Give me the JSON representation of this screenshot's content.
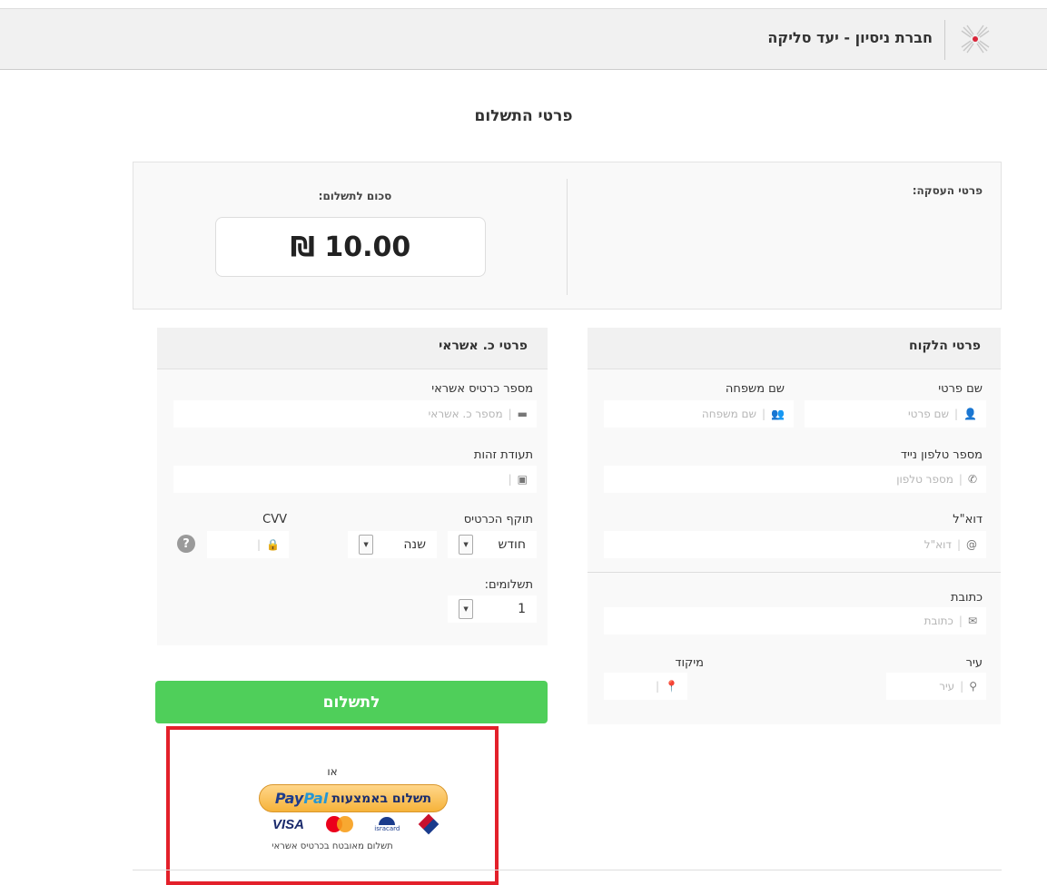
{
  "header": {
    "company_name": "חברת ניסיון - יעד סליקה"
  },
  "page": {
    "title": "פרטי התשלום"
  },
  "summary": {
    "deal_details_label": "פרטי העסקה:",
    "amount_label": "סכום לתשלום:",
    "amount_value": "10.00 ₪"
  },
  "customer": {
    "title": "פרטי הלקוח",
    "first_name_label": "שם פרטי",
    "first_name_placeholder": "שם פרטי",
    "last_name_label": "שם משפחה",
    "last_name_placeholder": "שם משפחה",
    "phone_label": "מספר טלפון נייד",
    "phone_placeholder": "מספר טלפון",
    "email_label": "דוא\"ל",
    "email_placeholder": "דוא\"ל",
    "address_label": "כתובת",
    "address_placeholder": "כתובת",
    "city_label": "עיר",
    "city_placeholder": "עיר",
    "zip_label": "מיקוד",
    "zip_placeholder": ""
  },
  "card": {
    "title": "פרטי כ. אשראי",
    "number_label": "מספר כרטיס אשראי",
    "number_placeholder": "מספר כ. אשראי",
    "id_label": "תעודת זהות",
    "id_placeholder": "",
    "expiry_label": "תוקף הכרטיס",
    "month_value": "חודש",
    "year_value": "שנה",
    "cvv_label": "CVV",
    "installments_label": "תשלומים:",
    "installments_value": "1",
    "help_symbol": "?"
  },
  "actions": {
    "pay_label": "לתשלום",
    "or_label": "או",
    "paypal_prefix": "תשלום באמצעות",
    "paypal_brand_pay": "Pay",
    "paypal_brand_pal": "Pal",
    "secure_note": "תשלום מאובטח בכרטיס אשראי"
  },
  "card_brands": {
    "visa": "VISA",
    "isracard": "isracard"
  },
  "colors": {
    "pay_button": "#4fcf5a",
    "highlight": "#e3202a",
    "paypal_gold": "#f6b33a"
  }
}
